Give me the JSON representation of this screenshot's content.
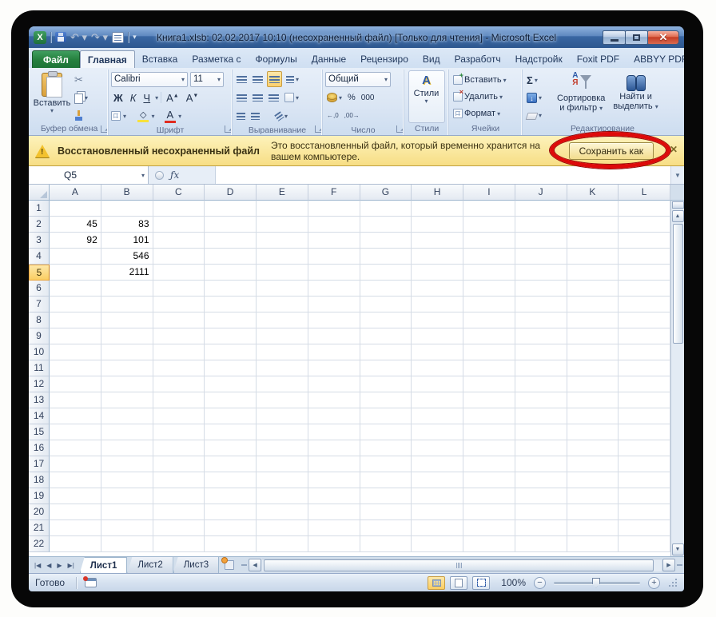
{
  "window": {
    "title": "Книга1.xlsb: 02.02.2017 10:10 (несохраненный файл)  [Только для чтения]  -  Microsoft Excel"
  },
  "colors": {
    "annotation_red": "#de0a0a",
    "file_tab_green": "#26813f",
    "message_bar_yellow": "#f7de85",
    "selected_row_orange": "#fbce62"
  },
  "ribbon_tabs": {
    "file": "Файл",
    "active": "Главная",
    "items": [
      "Главная",
      "Вставка",
      "Разметка с",
      "Формулы",
      "Данные",
      "Рецензиро",
      "Вид",
      "Разработч",
      "Надстройк",
      "Foxit PDF",
      "ABBYY PDF"
    ]
  },
  "ribbon": {
    "clipboard": {
      "label": "Буфер обмена",
      "paste": "Вставить"
    },
    "font": {
      "label": "Шрифт",
      "family": "Calibri",
      "size": "11",
      "bold": "Ж",
      "italic": "К",
      "underline": "Ч",
      "grow": "А",
      "shrink": "А",
      "color_a": "А"
    },
    "alignment": {
      "label": "Выравнивание"
    },
    "number": {
      "label": "Число",
      "format": "Общий",
      "percent": "%",
      "zeros": "000",
      "dec_inc": "←,0",
      "dec_dec": ",00→"
    },
    "styles": {
      "label": "Стили",
      "button": "Стили",
      "icon_letter": "А"
    },
    "cells": {
      "label": "Ячейки",
      "insert": "Вставить",
      "delete": "Удалить",
      "format": "Формат"
    },
    "editing": {
      "label": "Редактирование",
      "sigma": "Σ",
      "sort_line1": "Сортировка",
      "sort_line2": "и фильтр",
      "find_line1": "Найти и",
      "find_line2": "выделить"
    }
  },
  "message_bar": {
    "title": "Восстановленный несохраненный файл",
    "text": "Это восстановленный файл, который временно хранится на вашем компьютере.",
    "button": "Сохранить как",
    "close": "✕",
    "warn_mark": "!"
  },
  "formula_bar": {
    "name_box": "Q5",
    "fx": "ƒx"
  },
  "grid": {
    "columns": [
      "A",
      "B",
      "C",
      "D",
      "E",
      "F",
      "G",
      "H",
      "I",
      "J",
      "K",
      "L"
    ],
    "row_count": 22,
    "selected_row": 5,
    "cells": {
      "A2": "45",
      "B2": "83",
      "A3": "92",
      "B3": "101",
      "B4": "546",
      "B5": "2111"
    }
  },
  "sheet_tabs": {
    "active": "Лист1",
    "items": [
      "Лист1",
      "Лист2",
      "Лист3"
    ]
  },
  "status_bar": {
    "ready": "Готово",
    "zoom": "100%"
  }
}
